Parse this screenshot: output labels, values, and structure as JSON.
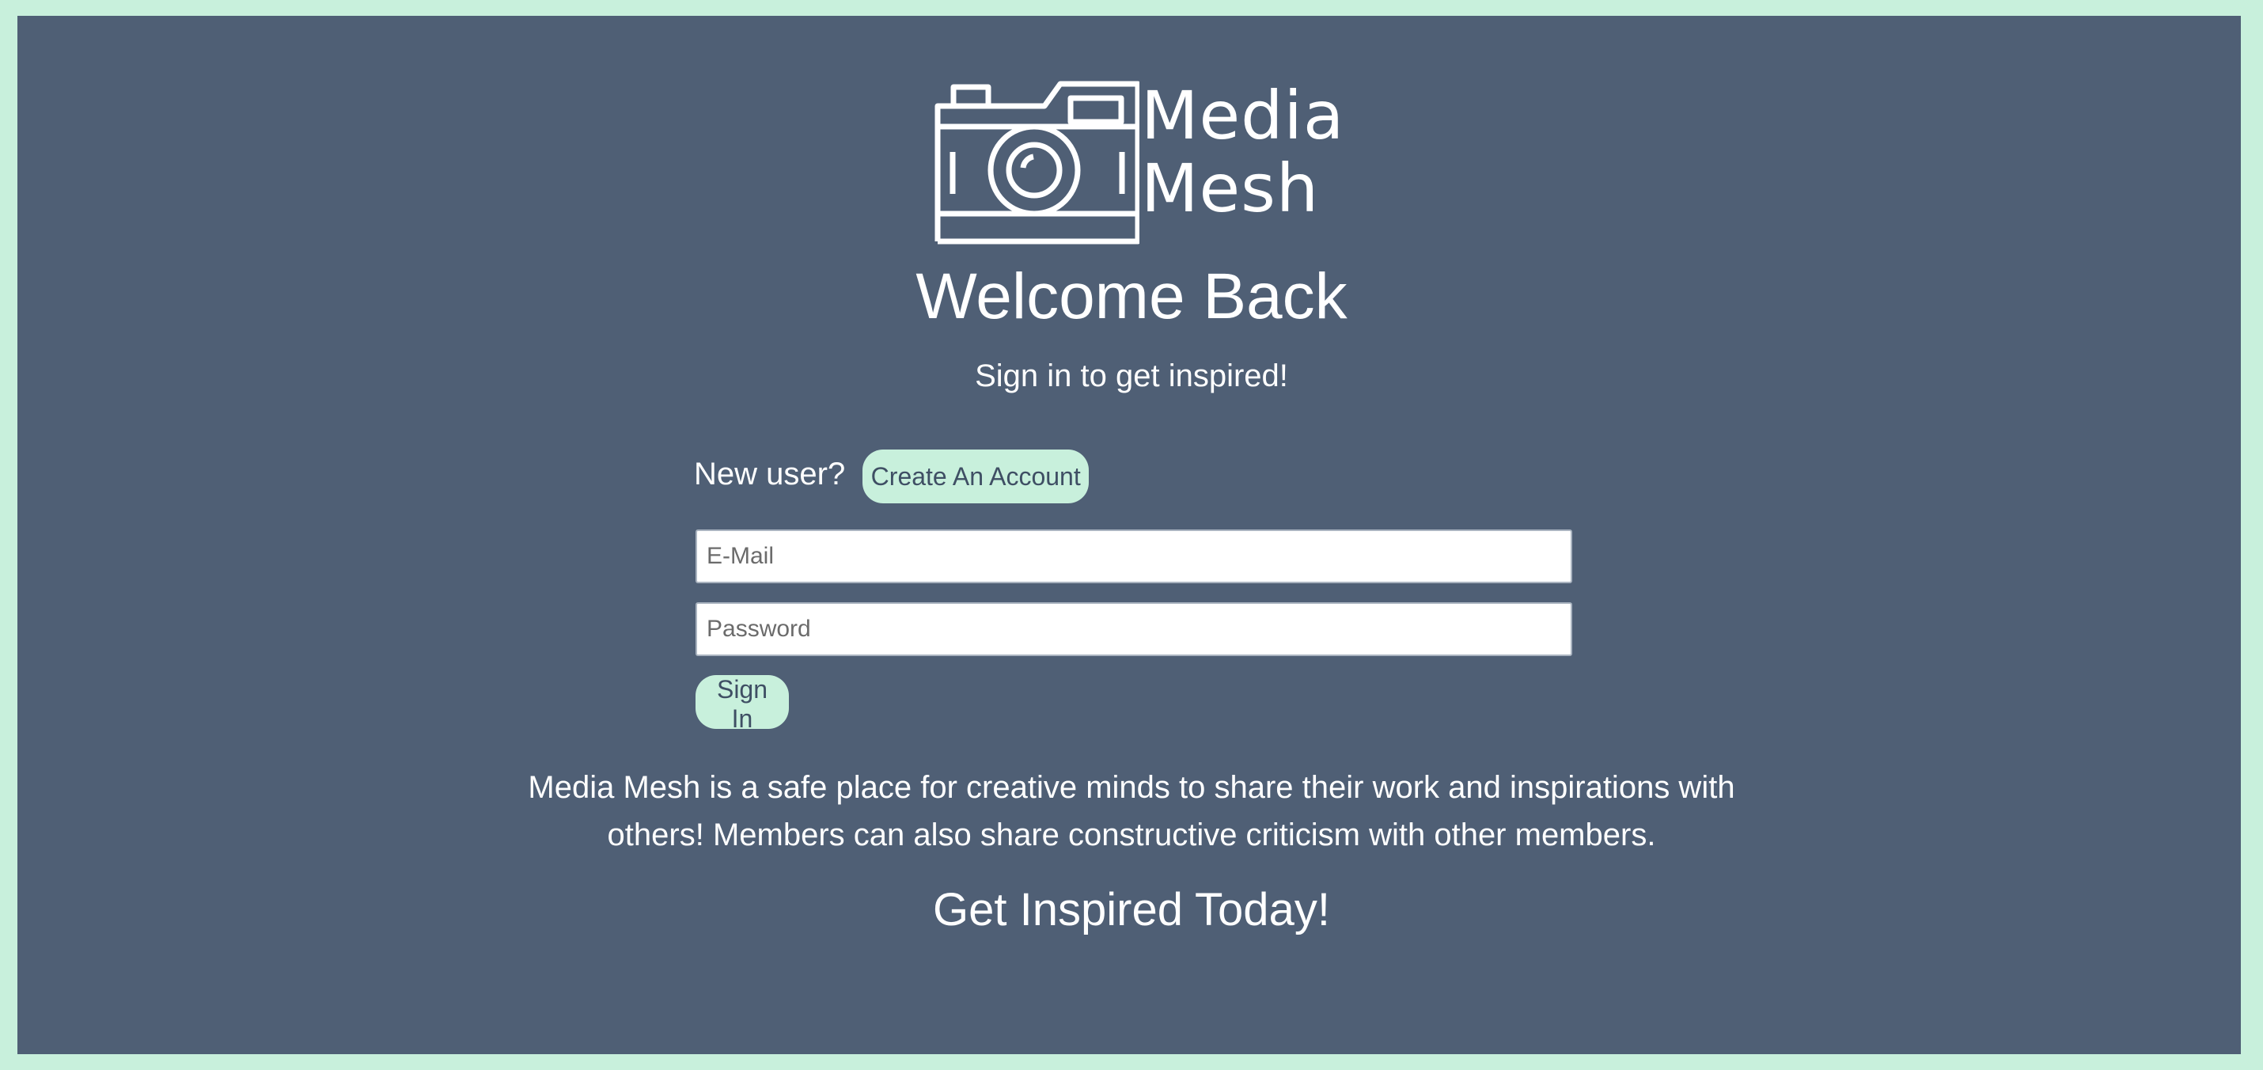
{
  "brand": {
    "name_line1": "Media",
    "name_line2": "Mesh",
    "logo_icon": "camera-icon"
  },
  "header": {
    "title": "Welcome Back",
    "subtitle": "Sign in to get inspired!"
  },
  "signup": {
    "prompt": "New user?",
    "button_label": "Create An Account"
  },
  "form": {
    "email_placeholder": "E-Mail",
    "email_value": "",
    "password_placeholder": "Password",
    "password_value": "",
    "submit_label": "Sign In"
  },
  "info": {
    "description_line1": "Media Mesh is a safe place for creative minds to share their work and inspirations with",
    "description_line2": "others! Members can also share constructive criticism with other members.",
    "tagline": "Get Inspired Today!"
  },
  "colors": {
    "page_border": "#c8f0dc",
    "panel_background": "#4f5f75",
    "button_background": "#c8f0dc",
    "button_text": "#3f4f64",
    "text": "#ffffff"
  }
}
